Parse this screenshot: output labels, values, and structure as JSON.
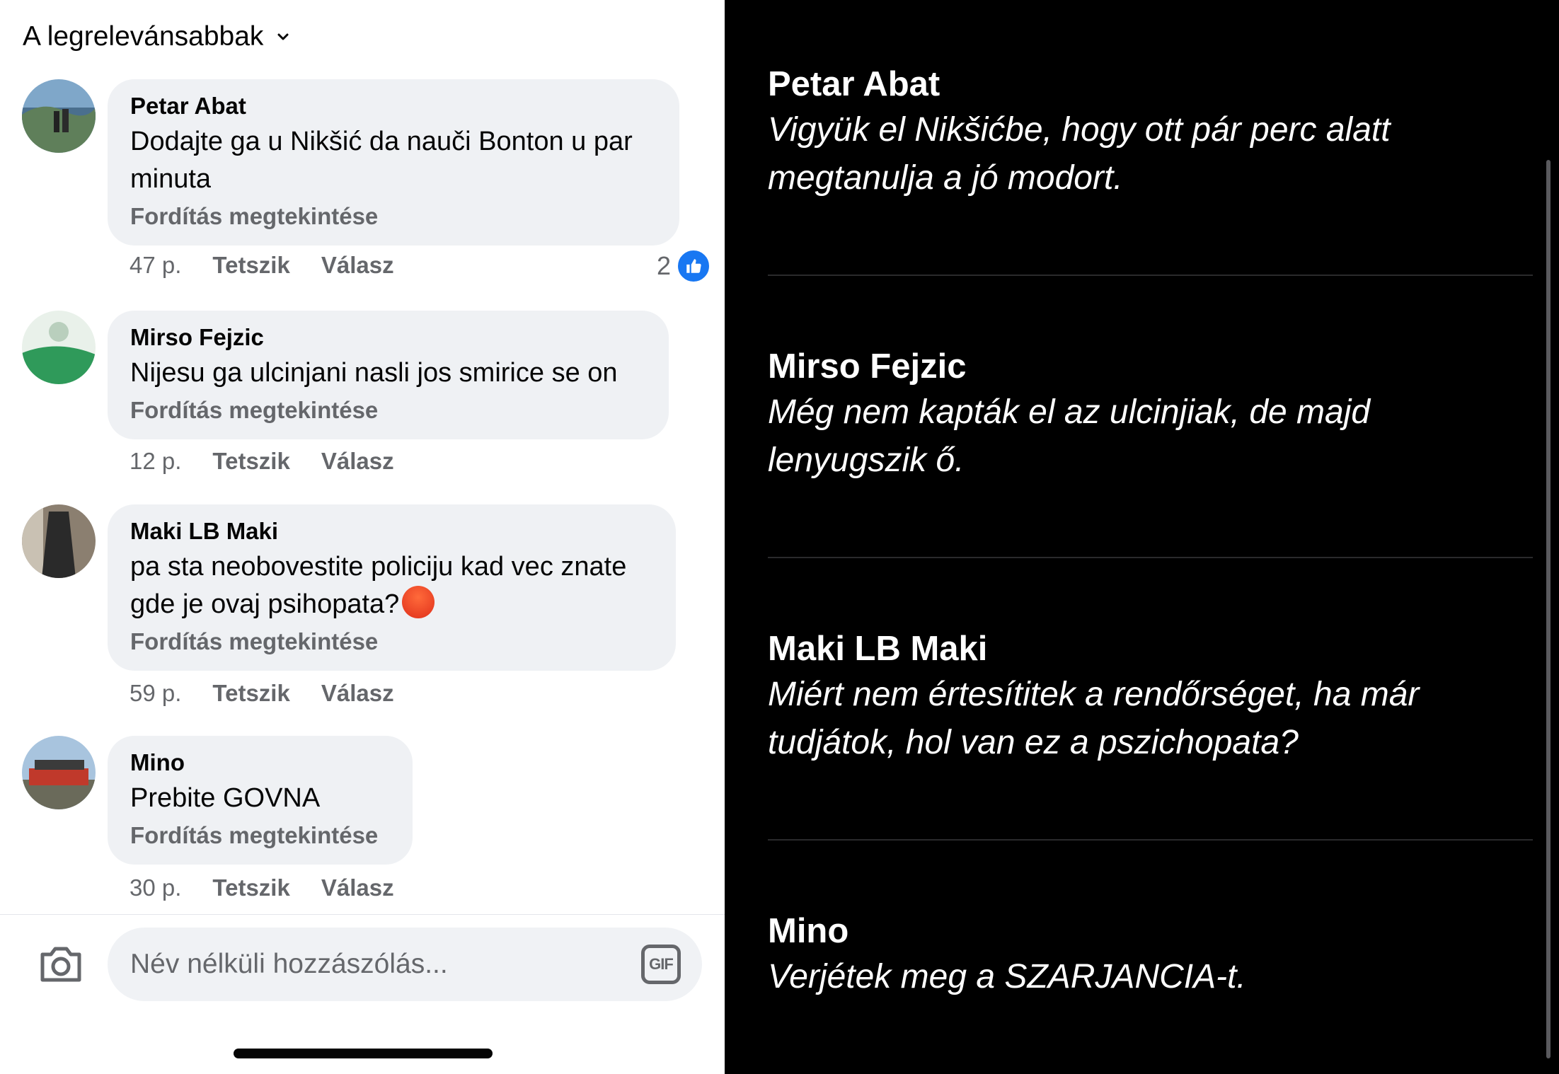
{
  "sort": {
    "label": "A legrelevánsabbak"
  },
  "comments": [
    {
      "author": "Petar Abat",
      "text": "Dodajte ga u Nikšić da nauči Bonton u par minuta",
      "translate": "Fordítás megtekintése",
      "time": "47 p.",
      "like": "Tetszik",
      "reply": "Válasz",
      "reactions": "2"
    },
    {
      "author": "Mirso Fejzic",
      "text": "Nijesu ga ulcinjani nasli jos  smirice se on",
      "translate": "Fordítás megtekintése",
      "time": "12 p.",
      "like": "Tetszik",
      "reply": "Válasz"
    },
    {
      "author": "Maki LB Maki",
      "text": "pa sta neobovestite policiju kad vec znate gde je ovaj psihopata?",
      "translate": "Fordítás megtekintése",
      "time": "59 p.",
      "like": "Tetszik",
      "reply": "Válasz"
    },
    {
      "author": "Mino",
      "text": "Prebite GOVNA",
      "translate": "Fordítás megtekintése",
      "time": "30 p.",
      "like": "Tetszik",
      "reply": "Válasz"
    }
  ],
  "composer": {
    "placeholder": "Név nélküli hozzászólás...",
    "gif": "GIF"
  },
  "translations": [
    {
      "name": "Petar Abat",
      "text": "Vigyük el Nikšićbe, hogy ott pár perc alatt megtanulja a jó modort."
    },
    {
      "name": "Mirso Fejzic",
      "text": "Még nem kapták el az ulcinjiak, de majd lenyugszik ő."
    },
    {
      "name": "Maki LB Maki",
      "text": "Miért nem értesítitek a rendőrséget, ha már tudjátok, hol van ez a pszichopata?"
    },
    {
      "name": "Mino",
      "text": "Verjétek meg a SZARJANCIA-t."
    }
  ],
  "colors": {
    "like_blue": "#1877f2",
    "bubble": "#eff1f4",
    "muted": "#65676b"
  }
}
